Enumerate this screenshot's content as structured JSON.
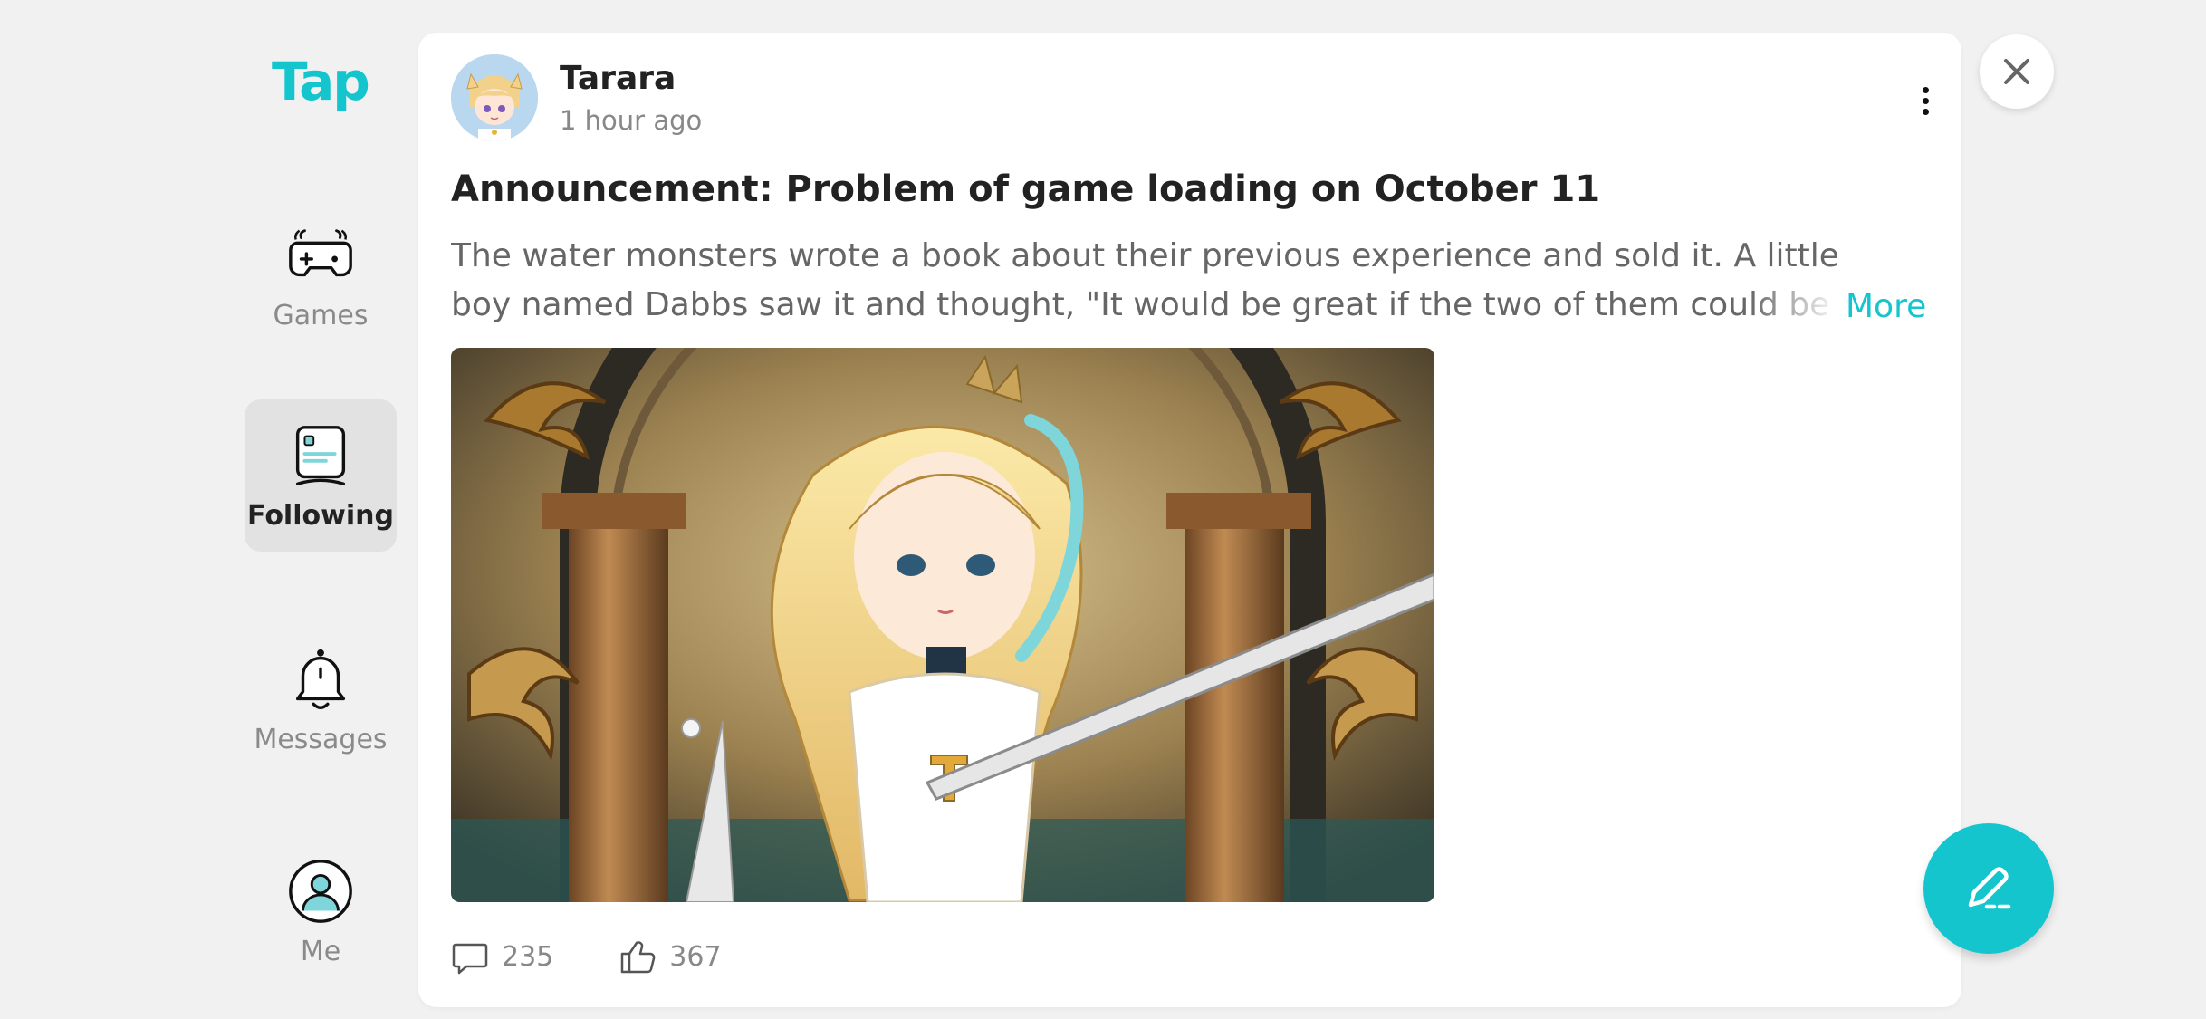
{
  "app": {
    "logo": "Tap",
    "accent_color": "#15c5ce"
  },
  "sidebar": {
    "items": [
      {
        "label": "Games",
        "icon": "gamepad-icon",
        "active": false
      },
      {
        "label": "Following",
        "icon": "following-feed-icon",
        "active": true
      },
      {
        "label": "Messages",
        "icon": "bell-icon",
        "active": false
      },
      {
        "label": "Me",
        "icon": "user-icon",
        "active": false
      }
    ]
  },
  "post": {
    "author": "Tarara",
    "time": "1 hour ago",
    "title": "Announcement: Problem of game loading on October 11",
    "body": "The water monsters wrote a book about their previous experience and sold it. A little boy named Dabbs saw it and thought, \"It would be great if the two of them could be together\"",
    "more_label": "More",
    "comments": "235",
    "likes": "367"
  },
  "actions": {
    "close_icon": "close-icon",
    "compose_icon": "pen-icon"
  }
}
